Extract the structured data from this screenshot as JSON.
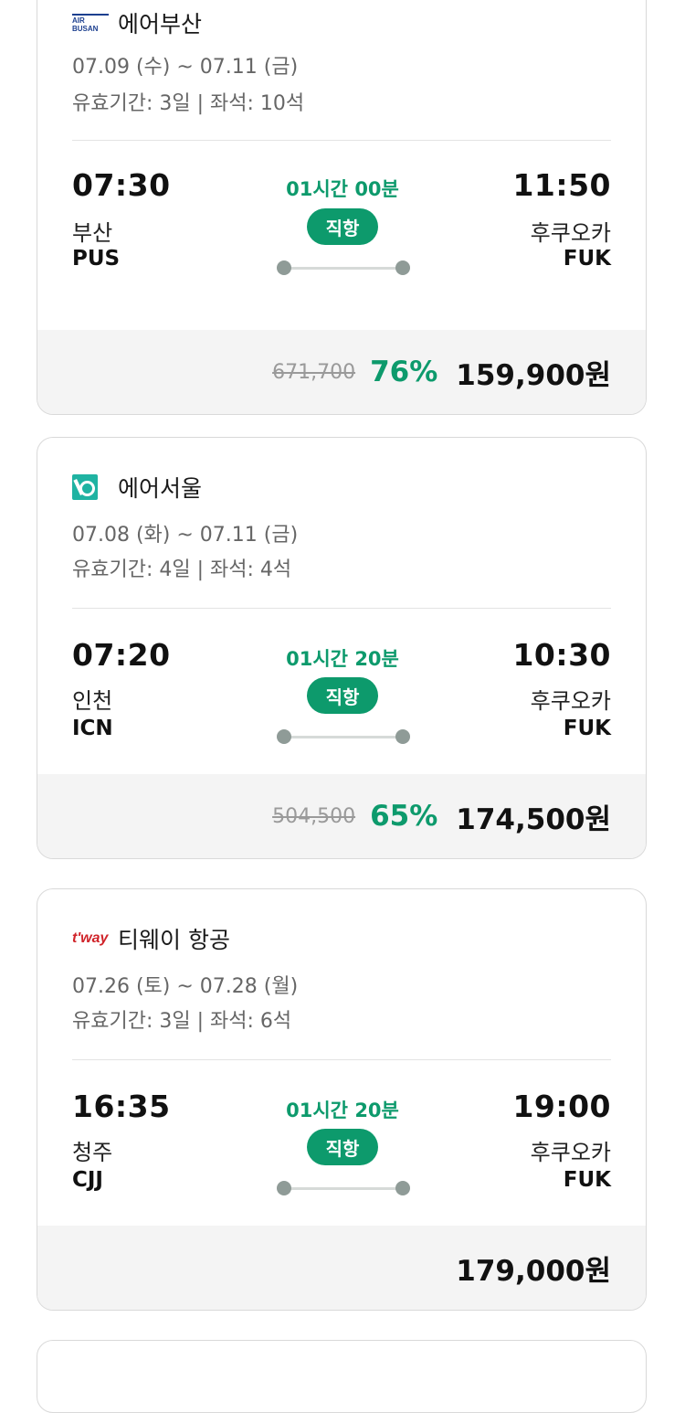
{
  "flights": [
    {
      "airline": "에어부산",
      "logo": "air-busan-logo",
      "logo_text": "AIR BUSAN",
      "dates": "07.09 (수) ~ 07.11 (금)",
      "validity": "유효기간: 3일 | 좌석: 10석",
      "dep_time": "07:30",
      "dep_city": "부산",
      "dep_code": "PUS",
      "arr_time": "11:50",
      "arr_city": "후쿠오카",
      "arr_code": "FUK",
      "duration": "01시간 00분",
      "badge": "직항",
      "original_price": "671,700",
      "discount": "76%",
      "price": "159,900원"
    },
    {
      "airline": "에어서울",
      "logo": "air-seoul-logo",
      "dates": "07.08 (화) ~ 07.11 (금)",
      "validity": "유효기간: 4일 | 좌석: 4석",
      "dep_time": "07:20",
      "dep_city": "인천",
      "dep_code": "ICN",
      "arr_time": "10:30",
      "arr_city": "후쿠오카",
      "arr_code": "FUK",
      "duration": "01시간 20분",
      "badge": "직항",
      "original_price": "504,500",
      "discount": "65%",
      "price": "174,500원"
    },
    {
      "airline": "티웨이 항공",
      "logo": "tway-logo",
      "logo_text": "t'way",
      "dates": "07.26 (토) ~ 07.28 (월)",
      "validity": "유효기간: 3일 | 좌석: 6석",
      "dep_time": "16:35",
      "dep_city": "청주",
      "dep_code": "CJJ",
      "arr_time": "19:00",
      "arr_city": "후쿠오카",
      "arr_code": "FUK",
      "duration": "01시간 20분",
      "badge": "직항",
      "price": "179,000원"
    }
  ],
  "colors": {
    "accent": "#0d9a6c",
    "card_border": "#d9d9d9",
    "price_bg": "#f4f4f4",
    "muted_text": "#666666"
  }
}
